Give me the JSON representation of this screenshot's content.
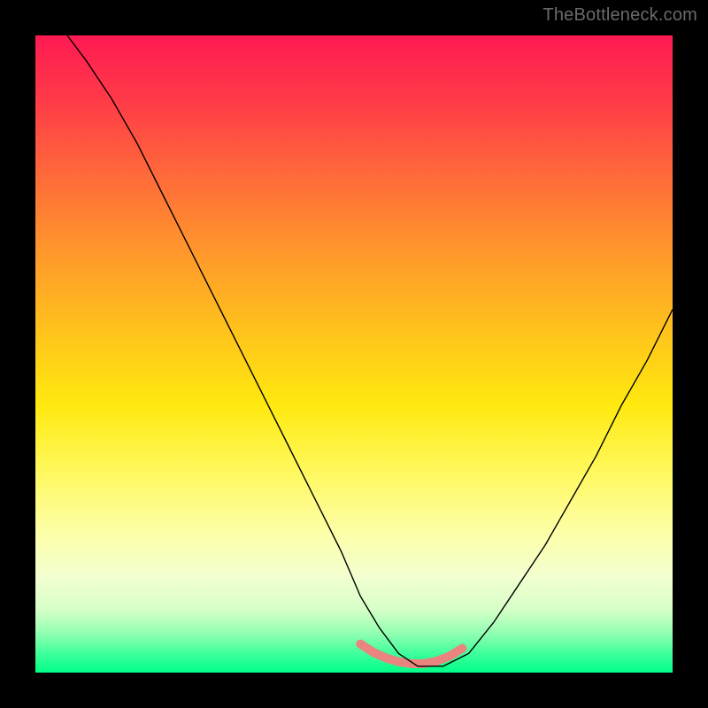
{
  "watermark": "TheBottleneck.com",
  "chart_data": {
    "type": "line",
    "title": "",
    "xlabel": "",
    "ylabel": "",
    "xlim": [
      0,
      100
    ],
    "ylim": [
      0,
      100
    ],
    "grid": false,
    "legend": false,
    "background_gradient": {
      "direction": "vertical",
      "stops": [
        {
          "pos": 0.0,
          "color": "#ff1a52"
        },
        {
          "pos": 0.1,
          "color": "#ff3a48"
        },
        {
          "pos": 0.22,
          "color": "#ff6a3a"
        },
        {
          "pos": 0.35,
          "color": "#ff9b2a"
        },
        {
          "pos": 0.48,
          "color": "#ffc81a"
        },
        {
          "pos": 0.58,
          "color": "#ffe90f"
        },
        {
          "pos": 0.68,
          "color": "#fff85a"
        },
        {
          "pos": 0.78,
          "color": "#fdffa8"
        },
        {
          "pos": 0.85,
          "color": "#f2ffd0"
        },
        {
          "pos": 0.9,
          "color": "#d8ffc8"
        },
        {
          "pos": 0.94,
          "color": "#8dffb0"
        },
        {
          "pos": 0.97,
          "color": "#3fff9c"
        },
        {
          "pos": 1.0,
          "color": "#00ff88"
        }
      ]
    },
    "series": [
      {
        "name": "bottleneck-curve",
        "color": "#000000",
        "width": 1.4,
        "x": [
          5,
          8,
          12,
          16,
          20,
          24,
          28,
          32,
          36,
          40,
          44,
          48,
          51,
          54,
          57,
          60,
          64,
          68,
          72,
          76,
          80,
          84,
          88,
          92,
          96,
          100
        ],
        "y": [
          100,
          96,
          90,
          83,
          75,
          67,
          59,
          51,
          43,
          35,
          27,
          19,
          12,
          7,
          3,
          1,
          1,
          3,
          8,
          14,
          20,
          27,
          34,
          42,
          49,
          57
        ]
      },
      {
        "name": "optimal-range-highlight",
        "color": "#e9847e",
        "width": 10,
        "x": [
          51,
          53,
          55,
          57,
          59,
          61,
          63,
          65,
          67
        ],
        "y": [
          4.5,
          3.2,
          2.3,
          1.7,
          1.4,
          1.4,
          1.8,
          2.6,
          3.8
        ]
      }
    ],
    "annotations": []
  }
}
